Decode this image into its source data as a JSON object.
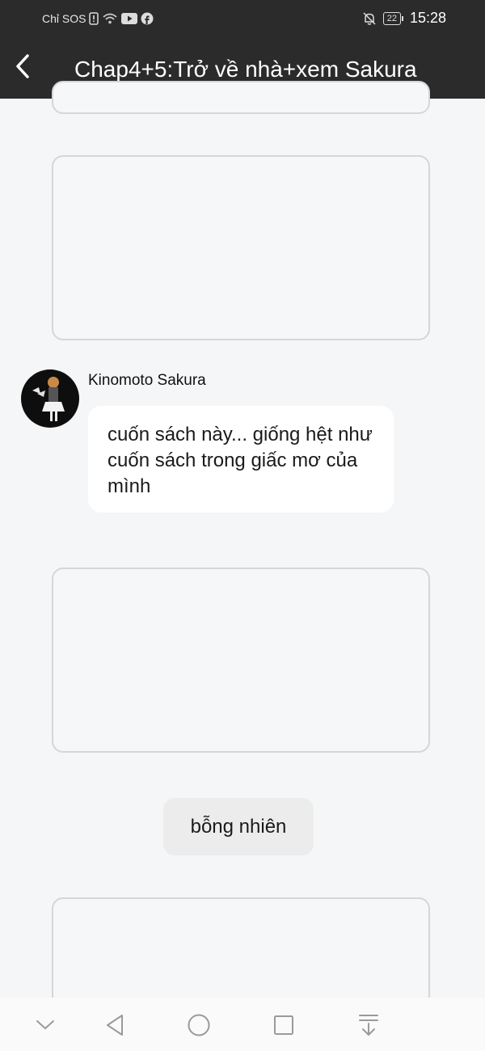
{
  "status_bar": {
    "carrier": "Chỉ SOS",
    "battery": "22",
    "time": "15:28",
    "icons": [
      "sim-alert-icon",
      "wifi-icon",
      "youtube-icon",
      "facebook-icon",
      "bell-muted-icon",
      "battery-icon"
    ]
  },
  "header": {
    "title": "Chap4+5:Trở về nhà+xem Sakura",
    "back_icon": "chevron-left-icon"
  },
  "content": {
    "image_cards": [
      {
        "id": "card-1"
      },
      {
        "id": "card-2"
      },
      {
        "id": "card-3"
      },
      {
        "id": "card-4"
      }
    ],
    "message": {
      "speaker": "Kinomoto Sakura",
      "text": "cuốn sách này... giống hệt như cuốn sách trong giấc mơ của mình"
    },
    "narration": "bỗng nhiên"
  },
  "nav_bar": {
    "buttons": [
      "chevron-down-icon",
      "back-triangle-icon",
      "home-circle-icon",
      "recents-square-icon",
      "download-icon"
    ]
  },
  "colors": {
    "header_bg": "#2b2b2b",
    "page_bg": "#f5f6f8",
    "bubble_bg": "#ffffff",
    "narration_bg": "#ececec",
    "card_border": "#d6d6d6"
  }
}
